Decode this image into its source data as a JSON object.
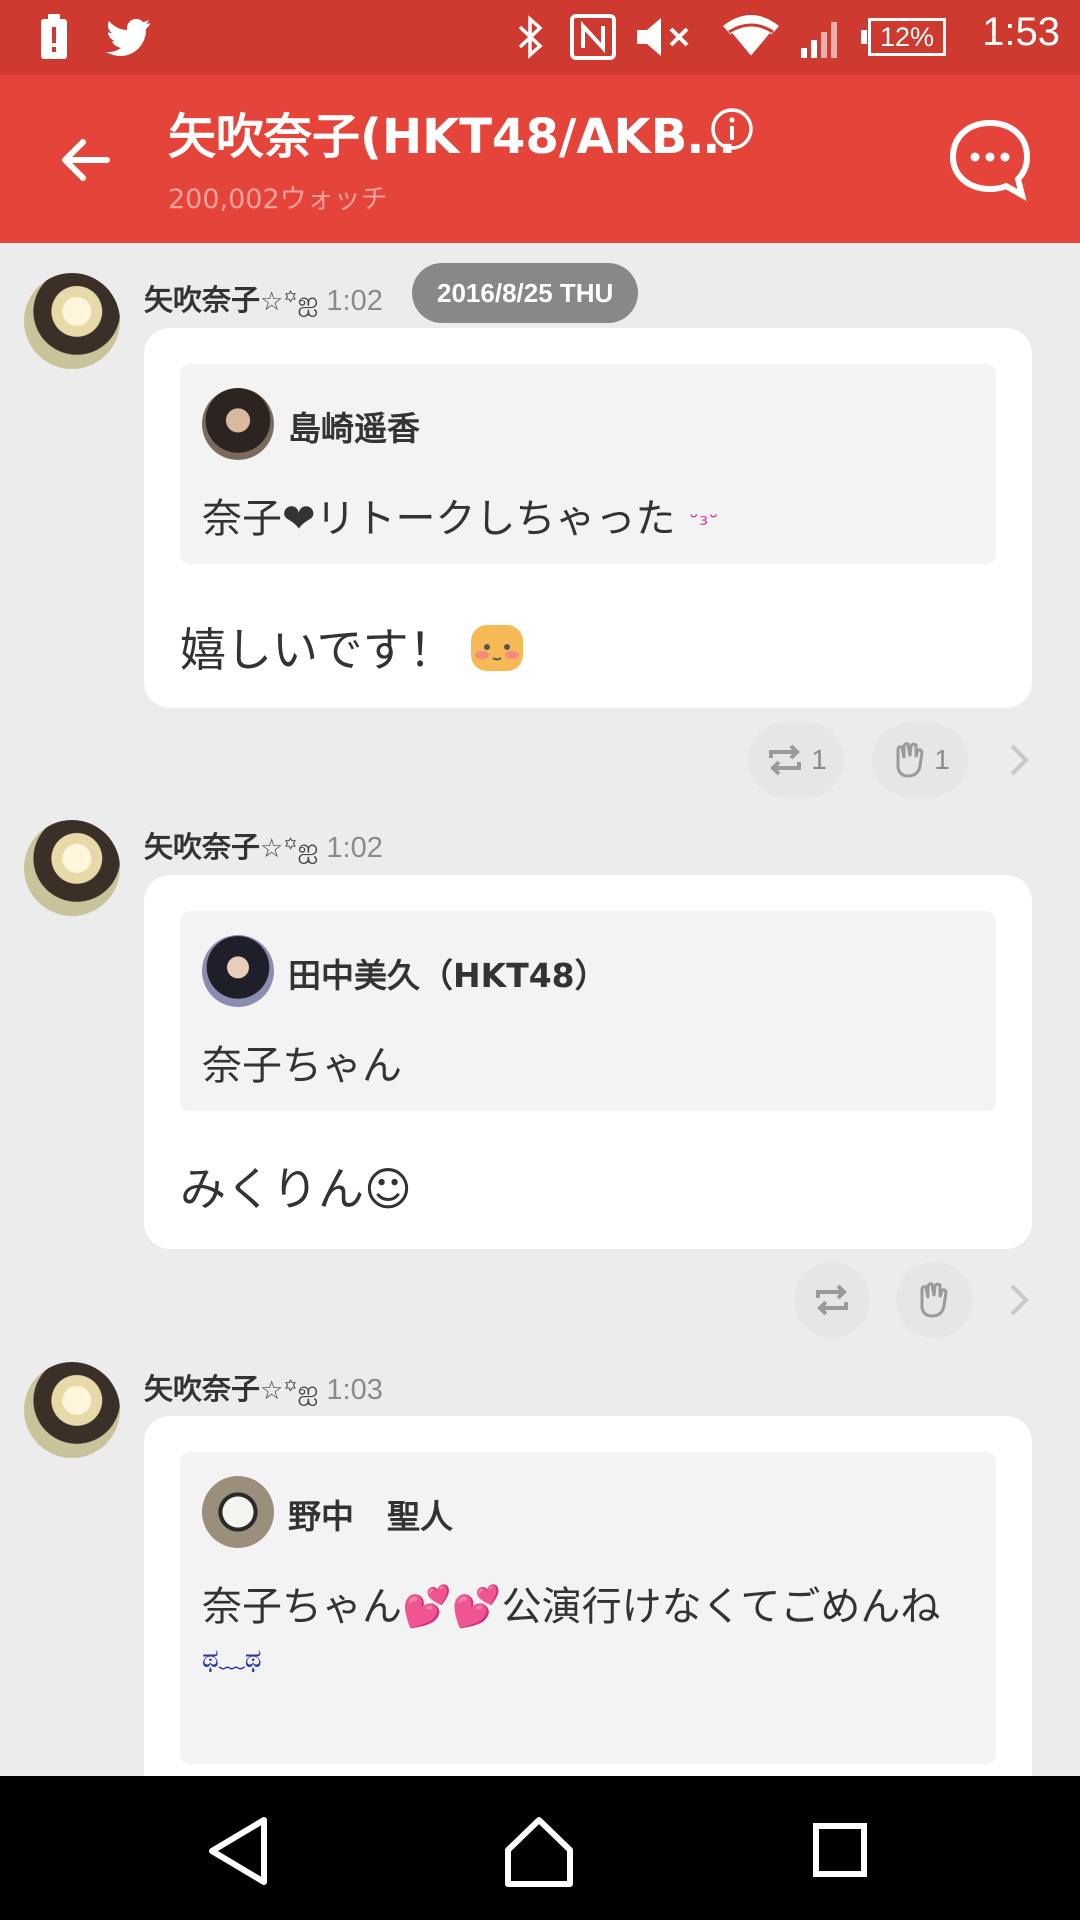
{
  "status_bar": {
    "time": "1:53",
    "battery": "12%",
    "icons": [
      "battery-alert-icon",
      "twitter-icon",
      "bluetooth-icon",
      "nfc-icon",
      "mute-icon",
      "wifi-icon",
      "signal-icon"
    ]
  },
  "app_bar": {
    "title": "矢吹奈子(HKT48/AKB…",
    "subtitle": "200,002ウォッチ"
  },
  "posts": [
    {
      "name": "矢吹奈子",
      "deco": "☆꙳ஐ",
      "time": "1:02",
      "date_badge": "2016/8/25 THU",
      "quote": {
        "author": "島崎遥香",
        "text": "奈子❤リトークしちゃった",
        "emoji": "˘³˘"
      },
      "reply": "嬉しいです！",
      "reply_emoji": "blush-face-icon",
      "retalk_count": "1",
      "clap_count": "1"
    },
    {
      "name": "矢吹奈子",
      "deco": "☆꙳ஐ",
      "time": "1:02",
      "quote": {
        "author": "田中美久（HKT48）",
        "text": "奈子ちゃん"
      },
      "reply": "みくりん☺",
      "retalk_count": "",
      "clap_count": ""
    },
    {
      "name": "矢吹奈子",
      "deco": "☆꙳ஐ",
      "time": "1:03",
      "quote": {
        "author": "野中　聖人",
        "text": "奈子ちゃん💕💕公演行けなくてごめんね",
        "text2": "ಥ﹏ಥ"
      }
    }
  ],
  "colors": {
    "status_bar": "#cf3a30",
    "app_bar": "#e5443a",
    "background": "#ececec"
  }
}
